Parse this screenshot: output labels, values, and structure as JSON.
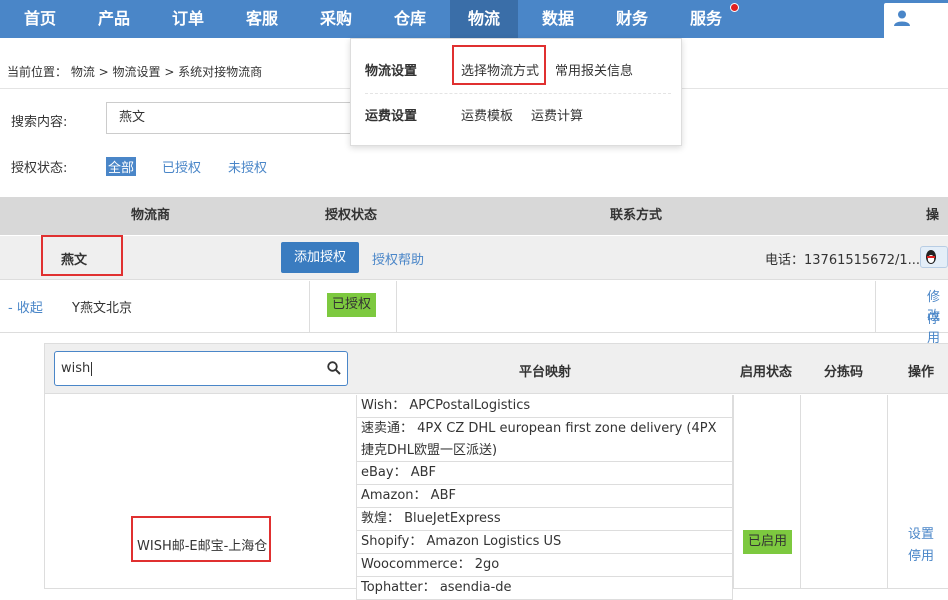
{
  "nav": {
    "items": [
      {
        "label": "首页"
      },
      {
        "label": "产品"
      },
      {
        "label": "订单"
      },
      {
        "label": "客服"
      },
      {
        "label": "采购"
      },
      {
        "label": "仓库"
      },
      {
        "label": "物流"
      },
      {
        "label": "数据"
      },
      {
        "label": "财务"
      },
      {
        "label": "服务"
      }
    ],
    "active": "物流"
  },
  "menu": {
    "group1": {
      "title": "物流设置",
      "items": [
        "选择物流方式",
        "常用报关信息"
      ]
    },
    "group2": {
      "title": "运费设置",
      "items": [
        "运费模板",
        "运费计算"
      ]
    }
  },
  "breadcrumb": "当前位置： 物流 > 物流设置 > 系统对接物流商",
  "search": {
    "label": "搜索内容:",
    "value": "燕文"
  },
  "auth_filter": {
    "label": "授权状态:",
    "options": [
      "全部",
      "已授权",
      "未授权"
    ],
    "selected": "全部"
  },
  "table": {
    "headers": [
      "物流商",
      "授权状态",
      "联系方式",
      "操作"
    ],
    "provider_row": {
      "name": "燕文",
      "add_button": "添加授权",
      "help_link": "授权帮助",
      "phone": "电话：13761515672/1..."
    },
    "account_row": {
      "collapse": "- 收起",
      "account": "Y燕文北京",
      "status": "已授权",
      "actions": [
        "修改",
        "停用"
      ]
    }
  },
  "inner": {
    "search_value": "wish",
    "headers": [
      "平台映射",
      "启用状态",
      "分拣码",
      "操作"
    ],
    "method_name": "WISH邮-E邮宝-上海仓",
    "mappings": [
      {
        "text": "Wish：  APCPostalLogistics"
      },
      {
        "text": "速卖通：  4PX CZ DHL european first zone delivery (4PX捷克DHL欧盟一区派送)"
      },
      {
        "text": "eBay：  ABF"
      },
      {
        "text": "Amazon：  ABF"
      },
      {
        "text": "敦煌：  BlueJetExpress"
      },
      {
        "text": "Shopify：  Amazon Logistics US"
      },
      {
        "text": "Woocommerce：  2go"
      },
      {
        "text": "Tophatter：  asendia-de"
      }
    ],
    "status": "已启用",
    "actions": [
      "设置",
      "停用"
    ]
  }
}
